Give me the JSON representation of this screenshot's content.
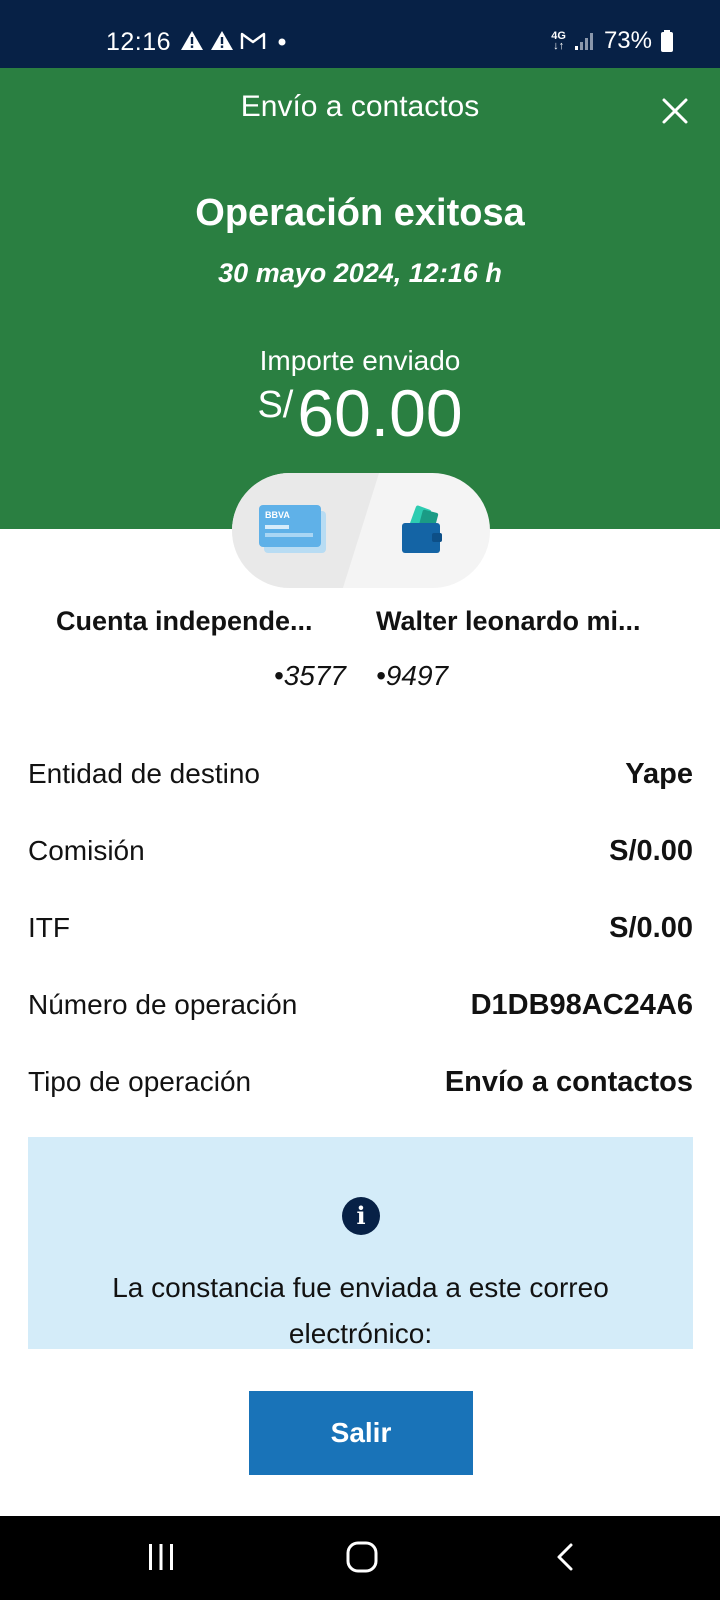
{
  "status_bar": {
    "time": "12:16",
    "network": "4G",
    "battery": "73%",
    "icons": [
      "warning-icon",
      "warning-icon",
      "gmail-icon",
      "dot-icon",
      "signal-icon",
      "battery-icon"
    ]
  },
  "header": {
    "title": "Envío a contactos",
    "close_icon": "close-icon",
    "success_title": "Operación exitosa",
    "date": "30 mayo 2024, 12:16 h",
    "amount_label": "Importe enviado",
    "currency": "S/",
    "amount": "60.00",
    "background": "#2a7f41"
  },
  "transfer": {
    "origin_card_brand": "BBVA",
    "origin_name": "Cuenta independe...",
    "origin_number": "•3577",
    "dest_name": "Walter leonardo mi...",
    "dest_number": "•9497"
  },
  "details": [
    {
      "label": "Entidad de destino",
      "value": "Yape"
    },
    {
      "label": "Comisión",
      "value": "S/0.00"
    },
    {
      "label": "ITF",
      "value": "S/0.00"
    },
    {
      "label": "Número de operación",
      "value": "D1DB98AC24A6"
    },
    {
      "label": "Tipo de operación",
      "value": "Envío a contactos"
    }
  ],
  "info": {
    "icon": "info-icon",
    "text": "La constancia fue enviada a este correo electrónico:"
  },
  "exit_button": "Salir",
  "colors": {
    "status_bar": "#072146",
    "button": "#1973b8",
    "info_box": "#d4ecf9"
  }
}
